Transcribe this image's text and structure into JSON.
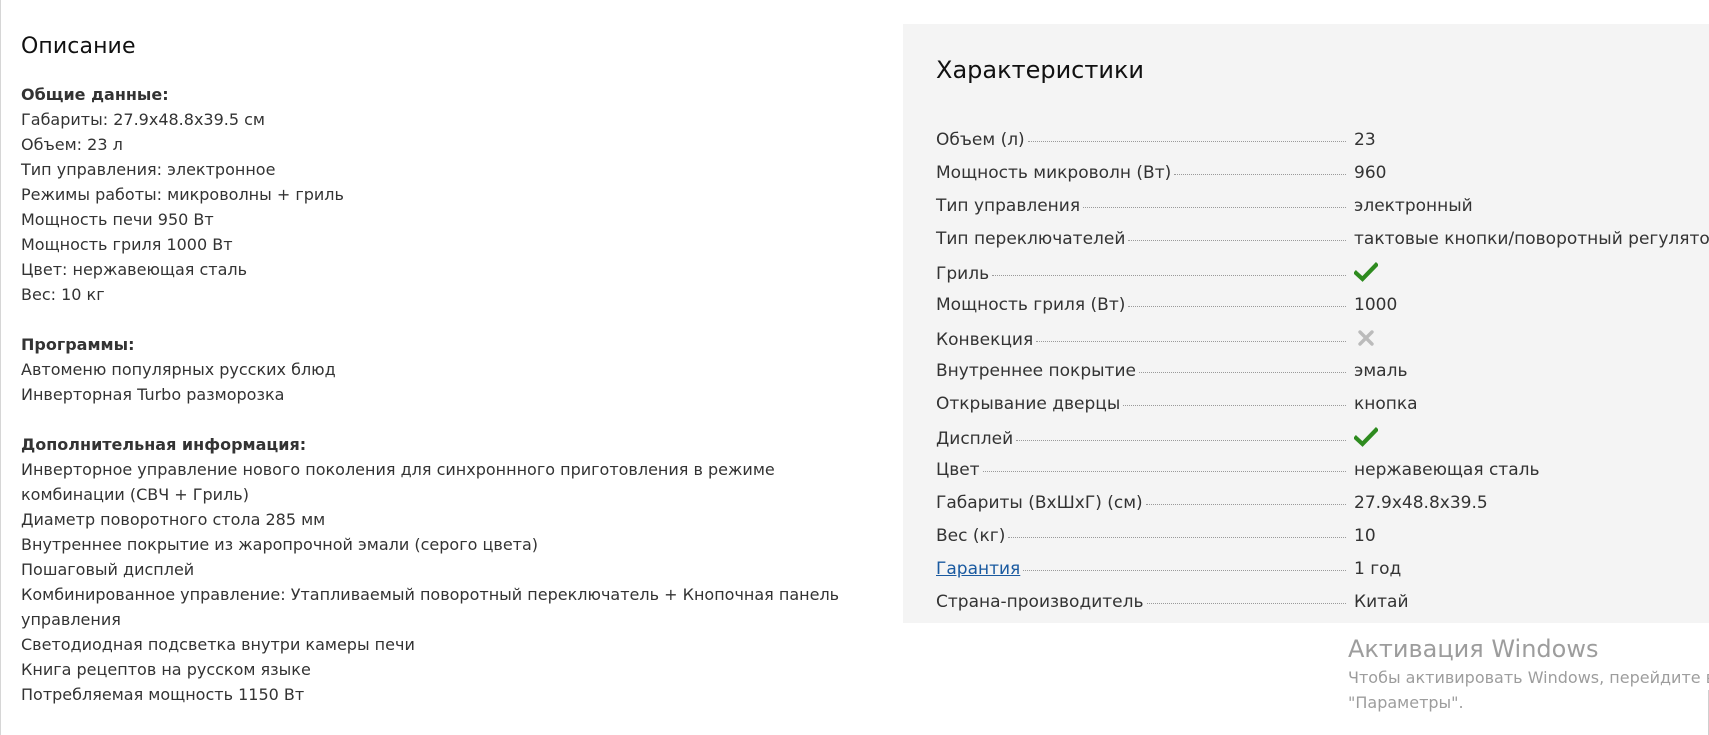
{
  "description": {
    "title": "Описание",
    "sections": [
      {
        "title": "Общие данные:",
        "lines": [
          "Габариты: 27.9x48.8x39.5 см",
          "Объем: 23 л",
          "Тип управления: электронное",
          "Режимы работы: микроволны + гриль",
          "Мощность печи 950 Вт",
          "Мощность гриля 1000 Вт",
          "Цвет: нержавеющая сталь",
          "Вес: 10 кг"
        ]
      },
      {
        "title": "Программы:",
        "lines": [
          "Автоменю популярных русских блюд",
          "Инверторная Turbo разморозка"
        ]
      },
      {
        "title": "Дополнительная информация:",
        "lines": [
          "Инверторное управление нового поколения для синхроннного приготовления в режиме",
          "комбинации (СВЧ + Гриль)",
          "Диаметр поворотного стола 285 мм",
          "Внутреннее покрытие из жаропрочной эмали (серого цвета)",
          "Пошаговый дисплей",
          "Комбинированное управление: Утапливаемый поворотный переключатель + Кнопочная панель",
          "управления",
          "Светодиодная подсветка внутри камеры печи",
          "Книга рецептов на русском языке",
          "Потребляемая мощность 1150 Вт"
        ]
      }
    ]
  },
  "specs": {
    "title": "Характеристики",
    "rows": [
      {
        "name": "Объем (л)",
        "value": "23"
      },
      {
        "name": "Мощность микроволн (Вт)",
        "value": "960"
      },
      {
        "name": "Тип управления",
        "value": "электронный"
      },
      {
        "name": "Тип переключателей",
        "value": "тактовые кнопки/поворотный регулятор"
      },
      {
        "name": "Гриль",
        "value": "",
        "icon": "check-icon"
      },
      {
        "name": "Мощность гриля (Вт)",
        "value": "1000"
      },
      {
        "name": "Конвекция",
        "value": "",
        "icon": "cross-icon"
      },
      {
        "name": "Внутреннее покрытие",
        "value": "эмаль"
      },
      {
        "name": "Открывание дверцы",
        "value": "кнопка"
      },
      {
        "name": "Дисплей",
        "value": "",
        "icon": "check-icon"
      },
      {
        "name": "Цвет",
        "value": "нержавеющая сталь"
      },
      {
        "name": "Габариты (ВхШхГ) (см)",
        "value": "27.9x48.8x39.5"
      },
      {
        "name": "Вес (кг)",
        "value": "10"
      },
      {
        "name": "Гарантия",
        "value": "1 год",
        "link": true
      },
      {
        "name": "Страна-производитель",
        "value": "Китай"
      }
    ]
  },
  "watermark": {
    "title": "Активация Windows",
    "line1": "Чтобы активировать Windows, перейдите в",
    "line2": "\"Параметры\"."
  },
  "colors": {
    "panel_bg": "#f4f4f4",
    "check": "#2e8b1f",
    "cross": "#bbbbbb",
    "link": "#1a5aa0"
  }
}
